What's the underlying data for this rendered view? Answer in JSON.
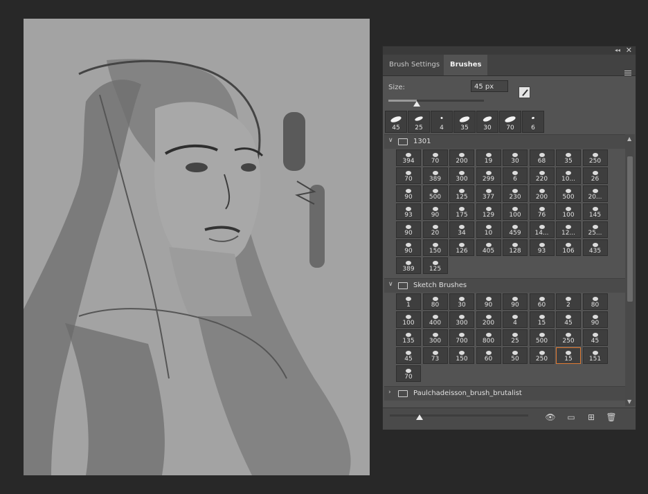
{
  "panel": {
    "tabs": [
      {
        "label": "Brush Settings",
        "active": false
      },
      {
        "label": "Brushes",
        "active": true
      }
    ],
    "collapse_glyph": "◂◂",
    "close_glyph": "✕"
  },
  "size": {
    "label": "Size:",
    "value": "45 px",
    "slider_fraction": 0.3
  },
  "recent_brushes": [
    "45",
    "25",
    "4",
    "35",
    "30",
    "70",
    "6"
  ],
  "groups": [
    {
      "name": "1301",
      "expanded": true,
      "brushes": [
        "394",
        "70",
        "200",
        "19",
        "30",
        "68",
        "35",
        "250",
        "70",
        "389",
        "300",
        "299",
        "6",
        "220",
        "10...",
        "26",
        "90",
        "500",
        "125",
        "377",
        "230",
        "200",
        "500",
        "20...",
        "93",
        "90",
        "175",
        "129",
        "100",
        "76",
        "100",
        "145",
        "90",
        "20",
        "34",
        "10",
        "459",
        "14...",
        "12...",
        "25...",
        "90",
        "150",
        "126",
        "405",
        "128",
        "93",
        "106",
        "435",
        "389",
        "125"
      ]
    },
    {
      "name": "Sketch Brushes",
      "expanded": true,
      "selected": "15",
      "brushes": [
        "1",
        "80",
        "30",
        "90",
        "90",
        "60",
        "2",
        "80",
        "100",
        "400",
        "300",
        "200",
        "4",
        "15",
        "45",
        "90",
        "135",
        "300",
        "700",
        "800",
        "25",
        "500",
        "250",
        "45",
        "45",
        "73",
        "150",
        "60",
        "50",
        "250",
        "15",
        "151",
        "70"
      ]
    },
    {
      "name": "Paulchadeisson_brush_brutalist",
      "expanded": false
    }
  ],
  "footer": {
    "preview_size_fraction": 0.2,
    "icons": [
      "visibility-icon",
      "new-group-folder-icon",
      "new-brush-icon",
      "delete-icon"
    ]
  },
  "colors": {
    "panel_bg": "#535353",
    "app_bg": "#282828",
    "canvas_bg": "#a3a3a3",
    "selection": "#e07a32"
  }
}
